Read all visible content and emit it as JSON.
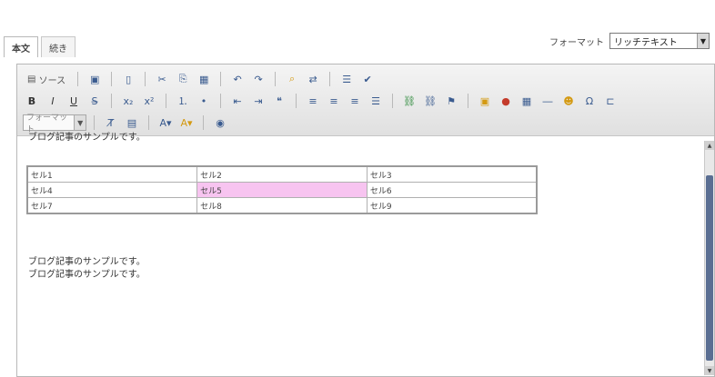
{
  "tabs": {
    "items": [
      "本文",
      "続き"
    ]
  },
  "format": {
    "label": "フォーマット",
    "value": "リッチテキスト"
  },
  "toolbar": {
    "source_label": "ソース",
    "style_label": "フォーマット"
  },
  "content": {
    "top_line": "ブログ記事のサンプルです。",
    "table": [
      [
        "セル1",
        "セル2",
        "セル3"
      ],
      [
        "セル4",
        "セル5",
        "セル6"
      ],
      [
        "セル7",
        "セル8",
        "セル9"
      ]
    ],
    "paragraph_lines": [
      "ブログ記事のサンプルです。",
      "ブログ記事のサンプルです。"
    ]
  },
  "colors": {
    "highlight": "#f7c4f0",
    "scroll_thumb": "#5a6e92"
  }
}
